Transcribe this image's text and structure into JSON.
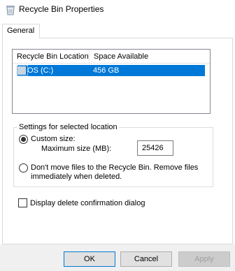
{
  "window": {
    "title": "Recycle Bin Properties",
    "icon": "recycle-bin-icon"
  },
  "tabs": [
    {
      "label": "General",
      "selected": true
    }
  ],
  "locations": {
    "columns": [
      "Recycle Bin Location",
      "Space Available"
    ],
    "rows": [
      {
        "location": "OS (C:)",
        "space": "456 GB",
        "selected": true,
        "icon": "drive-icon"
      }
    ]
  },
  "settings": {
    "group_label": "Settings for selected location",
    "custom_size_label": "Custom size:",
    "custom_size_checked": true,
    "max_size_label": "Maximum size (MB):",
    "max_size_value": "25426",
    "dont_move_label_line1": "Don't move files to the Recycle Bin. Remove files",
    "dont_move_label_line2": "immediately when deleted.",
    "dont_move_checked": false
  },
  "confirm": {
    "label": "Display delete confirmation dialog",
    "checked": false
  },
  "buttons": {
    "ok": "OK",
    "cancel": "Cancel",
    "apply": "Apply",
    "apply_enabled": false
  },
  "colors": {
    "selection": "#0078d7",
    "button_face": "#e1e1e1",
    "footer": "#f0f0f0"
  }
}
